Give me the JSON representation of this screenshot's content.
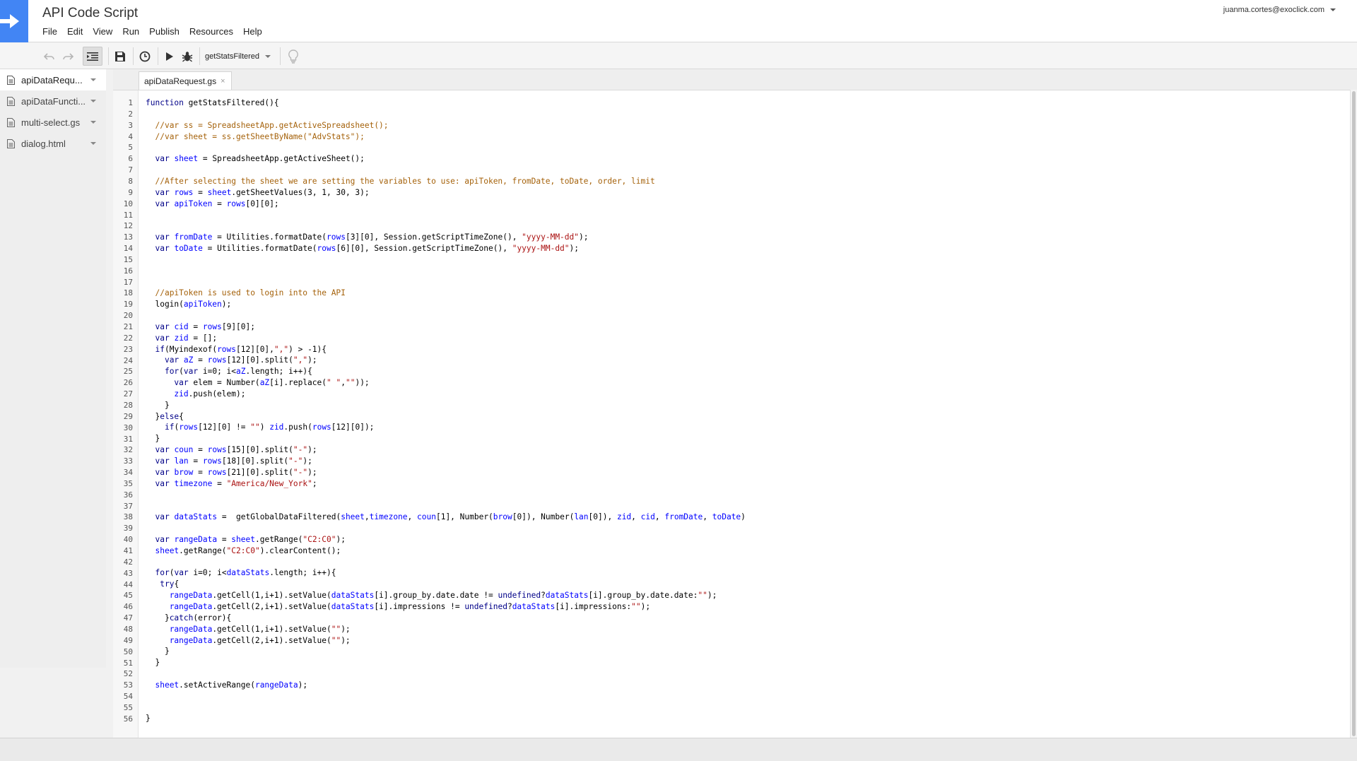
{
  "app": {
    "title": "API Code Script",
    "account": "juanma.cortes@exoclick.com"
  },
  "menu": [
    "File",
    "Edit",
    "View",
    "Run",
    "Publish",
    "Resources",
    "Help"
  ],
  "toolbar": {
    "selected_function": "getStatsFiltered",
    "icons": [
      "undo-icon",
      "redo-icon",
      "indent-icon",
      "save-icon",
      "triggers-clock-icon",
      "run-play-icon",
      "debug-bug-icon",
      "lightbulb-icon"
    ]
  },
  "sidebar": {
    "files": [
      {
        "label": "apiDataRequ...",
        "active": true
      },
      {
        "label": "apiDataFuncti...",
        "active": false
      },
      {
        "label": "multi-select.gs",
        "active": false
      },
      {
        "label": "dialog.html",
        "active": false
      }
    ]
  },
  "editor": {
    "tab_label": "apiDataRequest.gs",
    "tab_close": "×",
    "lines": [
      "function getStatsFiltered(){",
      "",
      "  //var ss = SpreadsheetApp.getActiveSpreadsheet();",
      "  //var sheet = ss.getSheetByName(\"AdvStats\");",
      "",
      "  var sheet = SpreadsheetApp.getActiveSheet();",
      "",
      "  //After selecting the sheet we are setting the variables to use: apiToken, fromDate, toDate, order, limit",
      "  var rows = sheet.getSheetValues(3, 1, 30, 3);",
      "  var apiToken = rows[0][0];",
      "",
      "",
      "  var fromDate = Utilities.formatDate(rows[3][0], Session.getScriptTimeZone(), \"yyyy-MM-dd\");",
      "  var toDate = Utilities.formatDate(rows[6][0], Session.getScriptTimeZone(), \"yyyy-MM-dd\");",
      "",
      "",
      "",
      "  //apiToken is used to login into the API",
      "  login(apiToken);",
      "",
      "  var cid = rows[9][0];",
      "  var zid = [];",
      "  if(Myindexof(rows[12][0],\",\") > -1){",
      "    var aZ = rows[12][0].split(\",\");",
      "    for(var i=0; i<aZ.length; i++){",
      "      var elem = Number(aZ[i].replace(\" \",\"\"));",
      "      zid.push(elem);",
      "    }",
      "  }else{",
      "    if(rows[12][0] != \"\") zid.push(rows[12][0]);",
      "  }",
      "  var coun = rows[15][0].split(\"-\");",
      "  var lan = rows[18][0].split(\"-\");",
      "  var brow = rows[21][0].split(\"-\");",
      "  var timezone = \"America/New_York\";",
      "",
      "",
      "  var dataStats =  getGlobalDataFiltered(sheet,timezone, coun[1], Number(brow[0]), Number(lan[0]), zid, cid, fromDate, toDate)",
      "",
      "  var rangeData = sheet.getRange(\"C2:C0\");",
      "  sheet.getRange(\"C2:C0\").clearContent();",
      "",
      "  for(var i=0; i<dataStats.length; i++){",
      "   try{",
      "     rangeData.getCell(1,i+1).setValue(dataStats[i].group_by.date.date != undefined?dataStats[i].group_by.date.date:\"\");",
      "     rangeData.getCell(2,i+1).setValue(dataStats[i].impressions != undefined?dataStats[i].impressions:\"\");",
      "    }catch(error){",
      "     rangeData.getCell(1,i+1).setValue(\"\");",
      "     rangeData.getCell(2,i+1).setValue(\"\");",
      "    }",
      "  }",
      "",
      "  sheet.setActiveRange(rangeData);",
      "",
      "",
      "}"
    ]
  }
}
